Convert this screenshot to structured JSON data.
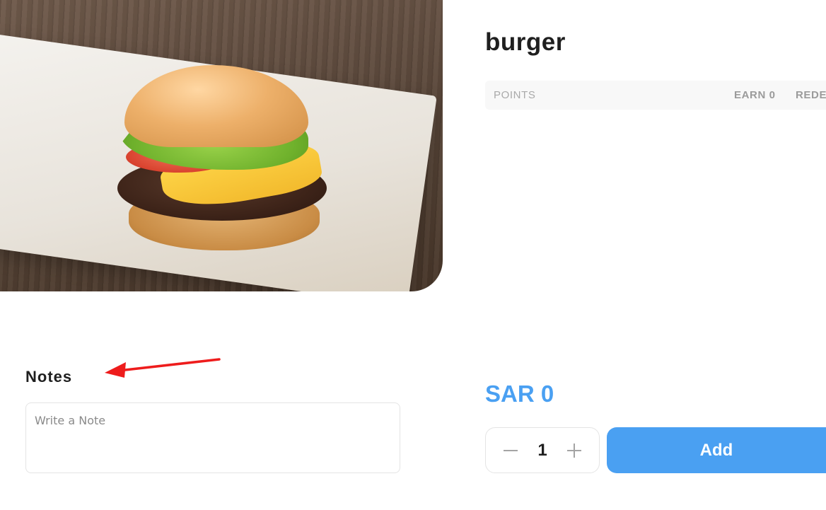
{
  "product": {
    "title": "burger"
  },
  "points": {
    "label": "POINTS",
    "earn": "EARN 0",
    "redeem": "REDEE"
  },
  "price": {
    "text": "SAR 0"
  },
  "quantity": {
    "value": "1",
    "decrement_icon": "minus-icon",
    "increment_icon": "plus-icon"
  },
  "add_button": {
    "label": "Add"
  },
  "notes": {
    "label": "Notes",
    "placeholder": "Write a Note",
    "value": ""
  },
  "colors": {
    "accent": "#4aa0f2",
    "annotation": "#ee1c1c"
  }
}
